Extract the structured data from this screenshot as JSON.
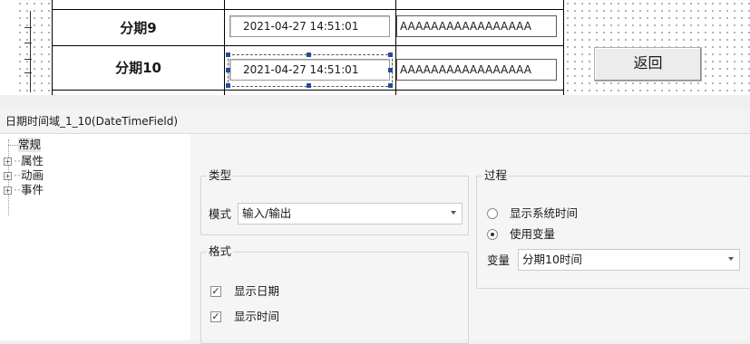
{
  "canvas": {
    "rows": [
      {
        "label": "分期9",
        "datetime": "2021-04-27 14:51:01",
        "text": "AAAAAAAAAAAAAAAAA"
      },
      {
        "label": "分期10",
        "datetime": "2021-04-27 14:51:01",
        "text": "AAAAAAAAAAAAAAAAA"
      }
    ],
    "return_button": "返回"
  },
  "panel": {
    "title": "日期时间域_1_10(DateTimeField)",
    "tree": {
      "items": [
        {
          "label": "常规",
          "expandable": false,
          "selected": true
        },
        {
          "label": "属性",
          "expandable": true
        },
        {
          "label": "动画",
          "expandable": true
        },
        {
          "label": "事件",
          "expandable": true
        }
      ],
      "expander_symbol": "+"
    },
    "type_group": {
      "legend": "类型",
      "mode_label": "模式",
      "mode_value": "输入/输出"
    },
    "format_group": {
      "legend": "格式",
      "show_date_label": "显示日期",
      "show_date_checked": true,
      "show_time_label": "显示时间",
      "show_time_checked": true
    },
    "process_group": {
      "legend": "过程",
      "option_system_time": "显示系统时间",
      "option_use_variable": "使用变量",
      "selected_option": "使用变量",
      "variable_label": "变量",
      "variable_value": "分期10时间"
    },
    "check_glyph": "✓"
  },
  "colors": {
    "selection_handle": "#1f4f9a",
    "canvas_background": "#ffffff",
    "panel_background": "#f5f5f5"
  }
}
